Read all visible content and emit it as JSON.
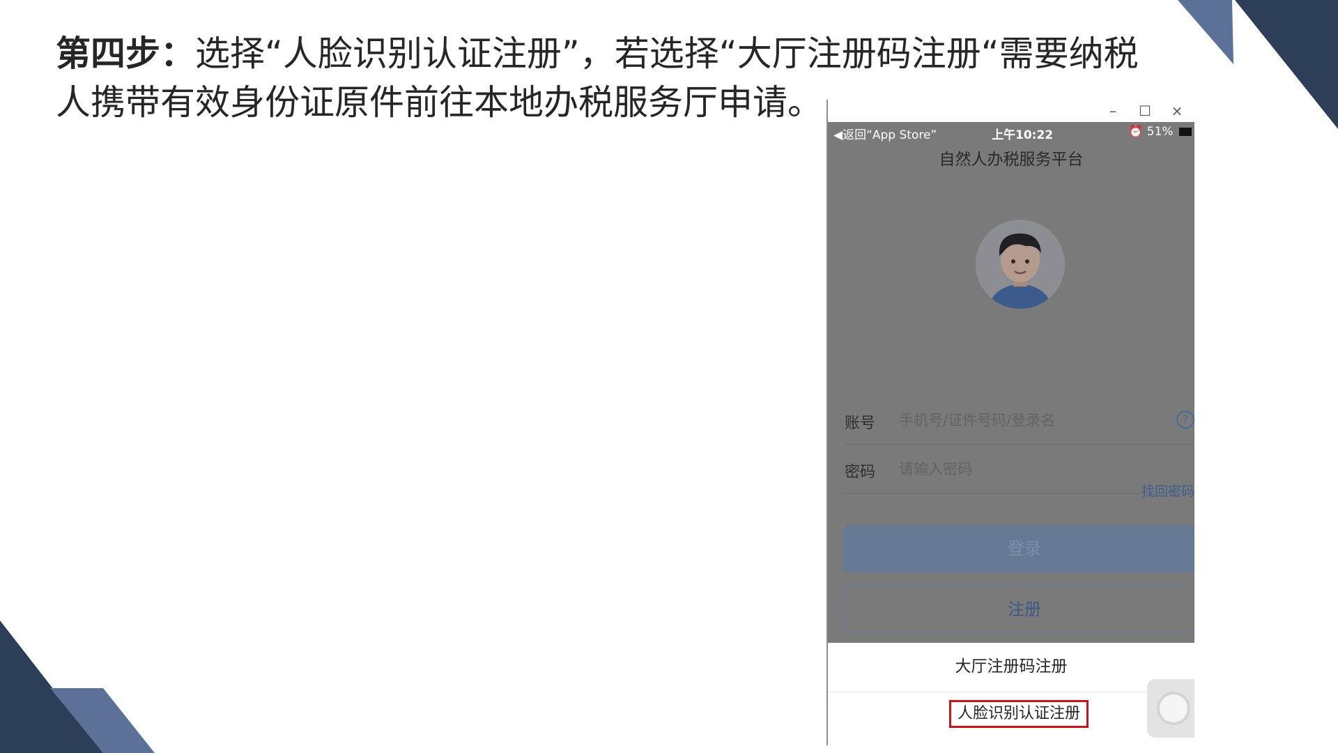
{
  "instruction": {
    "step_label": "第四步：",
    "text": "选择“人脸识别认证注册”，若选择“大厅注册码注册“需要纳税人携带有效身份证原件前往本地办税服务厅申请。"
  },
  "window": {
    "controls": {
      "minimize": "–",
      "maximize": "☐",
      "close": "×"
    }
  },
  "status_bar": {
    "back": "◀返回“App Store”",
    "time": "上午10:22",
    "battery": "51%"
  },
  "app": {
    "title": "自然人办税服务平台",
    "account": {
      "label": "账号",
      "placeholder": "手机号/证件号码/登录名",
      "help": "?"
    },
    "password": {
      "label": "密码",
      "placeholder": "请输入密码"
    },
    "forgot_password": "找回密码",
    "login_button": "登录",
    "register_button": "注册"
  },
  "action_sheet": {
    "option_hall_code": "大厅注册码注册",
    "option_face": "人脸识别认证注册"
  },
  "colors": {
    "header_navy": "#2c3e58",
    "header_blue": "#5b7198",
    "highlight_red": "#c0171f",
    "link_blue": "#3d5e8e"
  }
}
